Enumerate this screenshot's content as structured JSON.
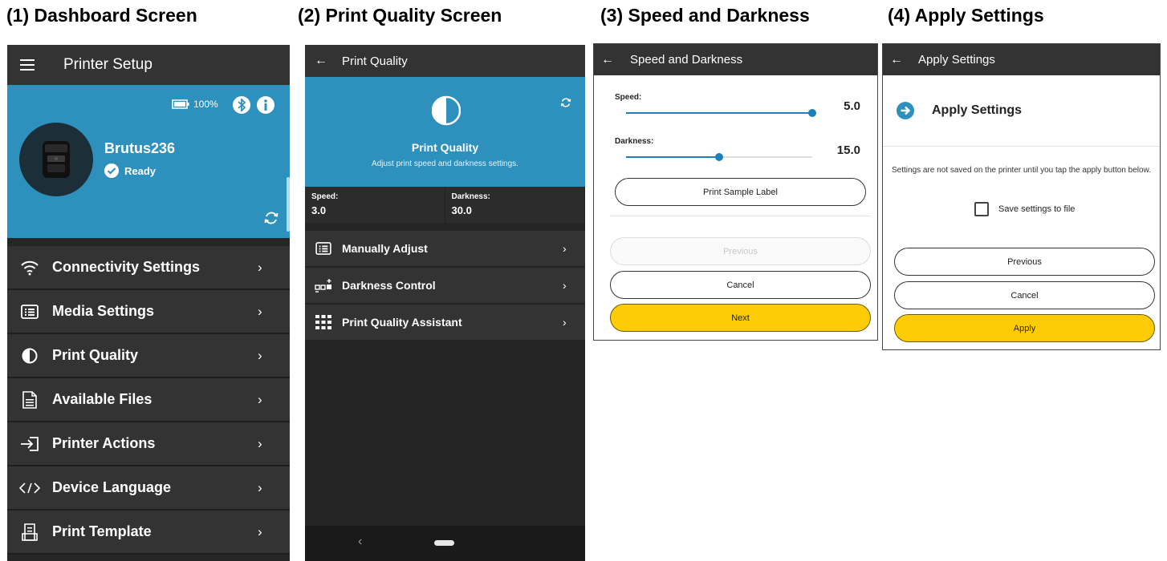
{
  "captions": {
    "c1": "(1) Dashboard Screen",
    "c2": "(2) Print Quality Screen",
    "c3": "(3) Speed and Darkness",
    "c4": "(4) Apply Settings"
  },
  "dashboard": {
    "title": "Printer Setup",
    "battery_percent": "100%",
    "device_name": "Brutus236",
    "status": "Ready",
    "menu": [
      {
        "label": "Connectivity Settings",
        "icon": "wifi-icon"
      },
      {
        "label": "Media Settings",
        "icon": "media-list-icon"
      },
      {
        "label": "Print Quality",
        "icon": "contrast-icon"
      },
      {
        "label": "Available Files",
        "icon": "file-icon"
      },
      {
        "label": "Printer Actions",
        "icon": "login-arrow-icon"
      },
      {
        "label": "Device Language",
        "icon": "code-icon"
      },
      {
        "label": "Print Template",
        "icon": "template-icon"
      }
    ]
  },
  "print_quality": {
    "title": "Print Quality",
    "hero_title": "Print Quality",
    "hero_subtitle": "Adjust print speed and darkness settings.",
    "speed_label": "Speed:",
    "speed_value": "3.0",
    "darkness_label": "Darkness:",
    "darkness_value": "30.0",
    "menu": [
      {
        "label": "Manually Adjust",
        "icon": "list-icon"
      },
      {
        "label": "Darkness Control",
        "icon": "darkness-control-icon"
      },
      {
        "label": "Print Quality Assistant",
        "icon": "grid-icon"
      }
    ]
  },
  "speed_darkness": {
    "title": "Speed and Darkness",
    "speed_label": "Speed:",
    "speed_value": "5.0",
    "speed_fraction": 1.0,
    "darkness_label": "Darkness:",
    "darkness_value": "15.0",
    "darkness_fraction": 0.5,
    "sample_button": "Print Sample Label",
    "previous_button": "Previous",
    "cancel_button": "Cancel",
    "next_button": "Next"
  },
  "apply_settings": {
    "title": "Apply Settings",
    "heading": "Apply Settings",
    "note": "Settings are not saved on the printer until you tap the apply button below.",
    "checkbox_label": "Save settings to file",
    "checkbox_checked": false,
    "previous_button": "Previous",
    "cancel_button": "Cancel",
    "apply_button": "Apply"
  },
  "colors": {
    "brand_blue": "#2e91bd",
    "slider_blue": "#1e80b8",
    "primary_yellow": "#fdcc04",
    "dark_bar": "#333333"
  }
}
